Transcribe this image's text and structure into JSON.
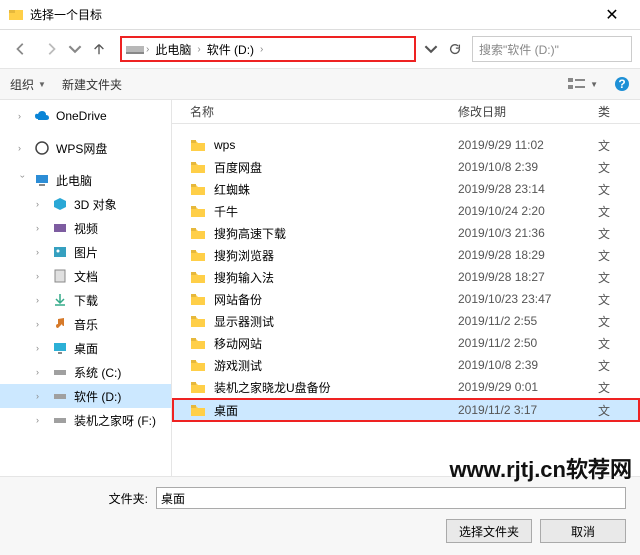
{
  "window": {
    "title": "选择一个目标"
  },
  "breadcrumb": {
    "pc": "此电脑",
    "drive": "软件 (D:)"
  },
  "search": {
    "placeholder": "搜索\"软件 (D:)\""
  },
  "toolbar": {
    "organize": "组织",
    "newfolder": "新建文件夹"
  },
  "columns": {
    "name": "名称",
    "date": "修改日期",
    "type": "类"
  },
  "sidebar": {
    "onedrive": "OneDrive",
    "wps": "WPS网盘",
    "thispc": "此电脑",
    "obj3d": "3D 对象",
    "videos": "视频",
    "pictures": "图片",
    "documents": "文档",
    "downloads": "下载",
    "music": "音乐",
    "desktop": "桌面",
    "sysc": "系统 (C:)",
    "softd": "软件 (D:)",
    "softe": "装机之家呀 (F:)"
  },
  "rows": [
    {
      "name": "wps",
      "date": "2019/9/29 11:02",
      "type": "文"
    },
    {
      "name": "百度网盘",
      "date": "2019/10/8 2:39",
      "type": "文"
    },
    {
      "name": "红蜘蛛",
      "date": "2019/9/28 23:14",
      "type": "文"
    },
    {
      "name": "千牛",
      "date": "2019/10/24 2:20",
      "type": "文"
    },
    {
      "name": "搜狗高速下载",
      "date": "2019/10/3 21:36",
      "type": "文"
    },
    {
      "name": "搜狗浏览器",
      "date": "2019/9/28 18:29",
      "type": "文"
    },
    {
      "name": "搜狗输入法",
      "date": "2019/9/28 18:27",
      "type": "文"
    },
    {
      "name": "网站备份",
      "date": "2019/10/23 23:47",
      "type": "文"
    },
    {
      "name": "显示器测试",
      "date": "2019/11/2 2:55",
      "type": "文"
    },
    {
      "name": "移动网站",
      "date": "2019/11/2 2:50",
      "type": "文"
    },
    {
      "name": "游戏测试",
      "date": "2019/10/8 2:39",
      "type": "文"
    },
    {
      "name": "装机之家晓龙U盘备份",
      "date": "2019/9/29 0:01",
      "type": "文"
    },
    {
      "name": "桌面",
      "date": "2019/11/2 3:17",
      "type": "文",
      "hl": true
    }
  ],
  "top_partial": {
    "date_fragment": ""
  },
  "bottom": {
    "folder_label": "文件夹:",
    "value": "桌面",
    "select": "选择文件夹",
    "cancel": "取消"
  },
  "watermark": "www.rjtj.cn软荐网"
}
